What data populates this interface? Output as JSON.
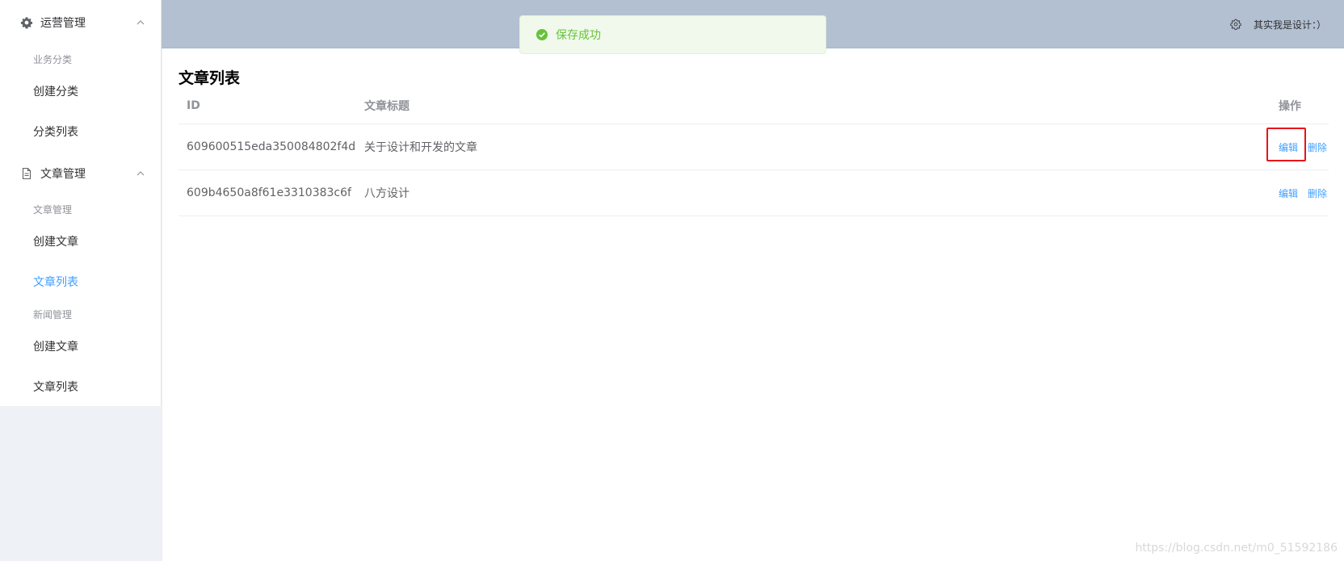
{
  "sidebar": {
    "groups": [
      {
        "title": "运营管理",
        "icon": "gear-icon",
        "sections": [
          {
            "title": "业务分类",
            "items": [
              {
                "label": "创建分类",
                "active": false
              },
              {
                "label": "分类列表",
                "active": false
              }
            ]
          }
        ]
      },
      {
        "title": "文章管理",
        "icon": "document-icon",
        "sections": [
          {
            "title": "文章管理",
            "items": [
              {
                "label": "创建文章",
                "active": false
              },
              {
                "label": "文章列表",
                "active": true
              }
            ]
          },
          {
            "title": "新闻管理",
            "items": [
              {
                "label": "创建文章",
                "active": false
              },
              {
                "label": "文章列表",
                "active": false
              }
            ]
          }
        ]
      }
    ]
  },
  "header": {
    "settings_icon": "gear-icon",
    "username": "其实我是设计：）"
  },
  "toast": {
    "type": "success",
    "icon": "check-circle-icon",
    "message": "保存成功"
  },
  "main": {
    "title": "文章列表",
    "table": {
      "columns": [
        "ID",
        "文章标题",
        "操作"
      ],
      "rows": [
        {
          "id": "609600515eda350084802f4d",
          "title": "关于设计和开发的文章",
          "actions": [
            "编辑",
            "删除"
          ]
        },
        {
          "id": "609b4650a8f61e3310383c6f",
          "title": "八方设计",
          "actions": [
            "编辑",
            "删除"
          ]
        }
      ]
    }
  },
  "watermark": "https://blog.csdn.net/m0_51592186",
  "colors": {
    "accent": "#409eff",
    "header_bg": "#b3c0d1",
    "sidebar_bg": "#eef1f6",
    "success_text": "#67c23a",
    "success_bg": "#f0f9eb",
    "highlight_box": "#e8131c"
  }
}
